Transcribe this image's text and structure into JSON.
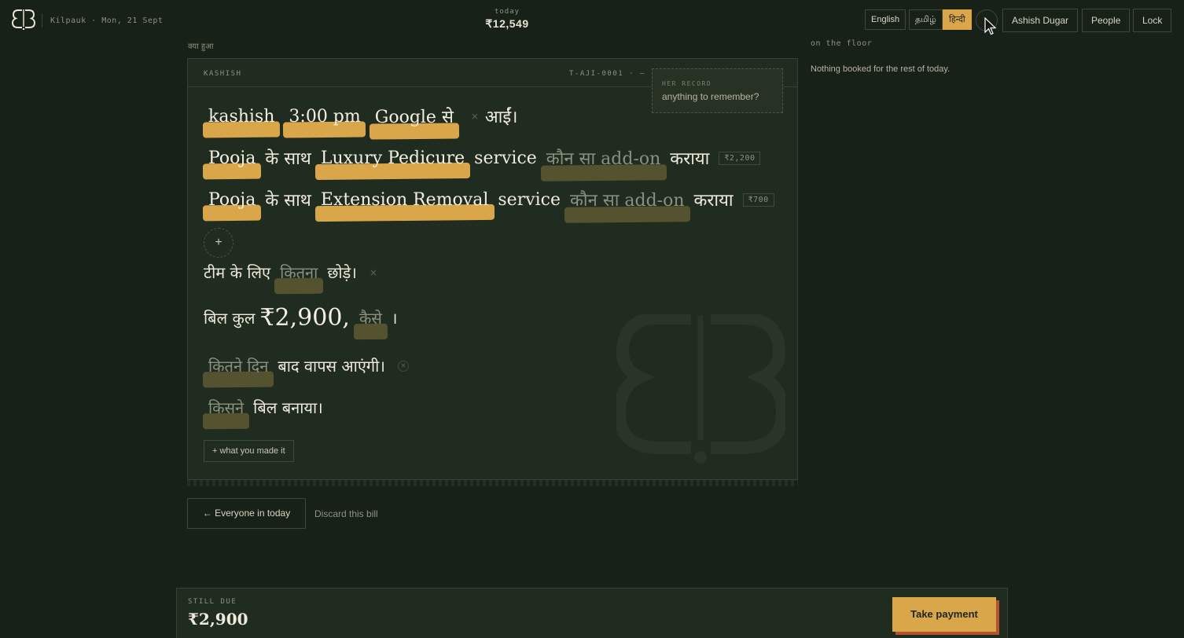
{
  "topbar": {
    "location_date": "Kilpauk · Mon, 21 Sept",
    "today_label": "today",
    "today_amount": "₹12,549",
    "languages": [
      "English",
      "தமிழ்",
      "हिन्दी"
    ],
    "active_language": "हिन्दी",
    "user": "Ashish Dugar",
    "people": "People",
    "lock": "Lock"
  },
  "bill": {
    "heading": "क्या हुआ",
    "client_label": "KASHISH",
    "ticket": "T-AJI-0001 · —",
    "record_label": "HER RECORD",
    "record_placeholder": "anything to remember?",
    "line1": {
      "name": "kashish",
      "time": "3:00 pm",
      "source": "Google से",
      "x": "×",
      "end": "आईं।"
    },
    "services": [
      {
        "staff": "Pooja",
        "with": "के साथ",
        "service": "Luxury Pedicure",
        "word": "service",
        "addon": "कौन सा add-on",
        "did": "कराया",
        "price": "₹2,200"
      },
      {
        "staff": "Pooja",
        "with": "के साथ",
        "service": "Extension Removal",
        "word": "service",
        "addon": "कौन सा add-on",
        "did": "कराया",
        "price": "₹700"
      }
    ],
    "plus": "+",
    "tip": {
      "pre": "टीम के लिए",
      "blank": "कितना",
      "post": "छोड़े।",
      "x": "×"
    },
    "total": {
      "pre": "बिल कुल",
      "amount": "₹2,900,",
      "blank": "कैसे",
      "post": "।"
    },
    "return": {
      "blank": "कितने दिन",
      "post": "बाद वापस आएंगी।",
      "x": "×"
    },
    "maker": {
      "blank": "किसने",
      "post": "बिल बनाया।"
    },
    "made_button": "+ what you made it"
  },
  "floor": {
    "label": "on the floor",
    "text": "Nothing booked for the rest of today."
  },
  "actions": {
    "back": "← Everyone in today",
    "discard": "Discard this bill"
  },
  "due": {
    "label": "STILL DUE",
    "amount": "₹2,900",
    "pay_button": "Take payment"
  },
  "colors": {
    "background": "#182118",
    "card": "#212c21",
    "accent": "#d9a74a",
    "pay_shadow": "#b5532f"
  }
}
